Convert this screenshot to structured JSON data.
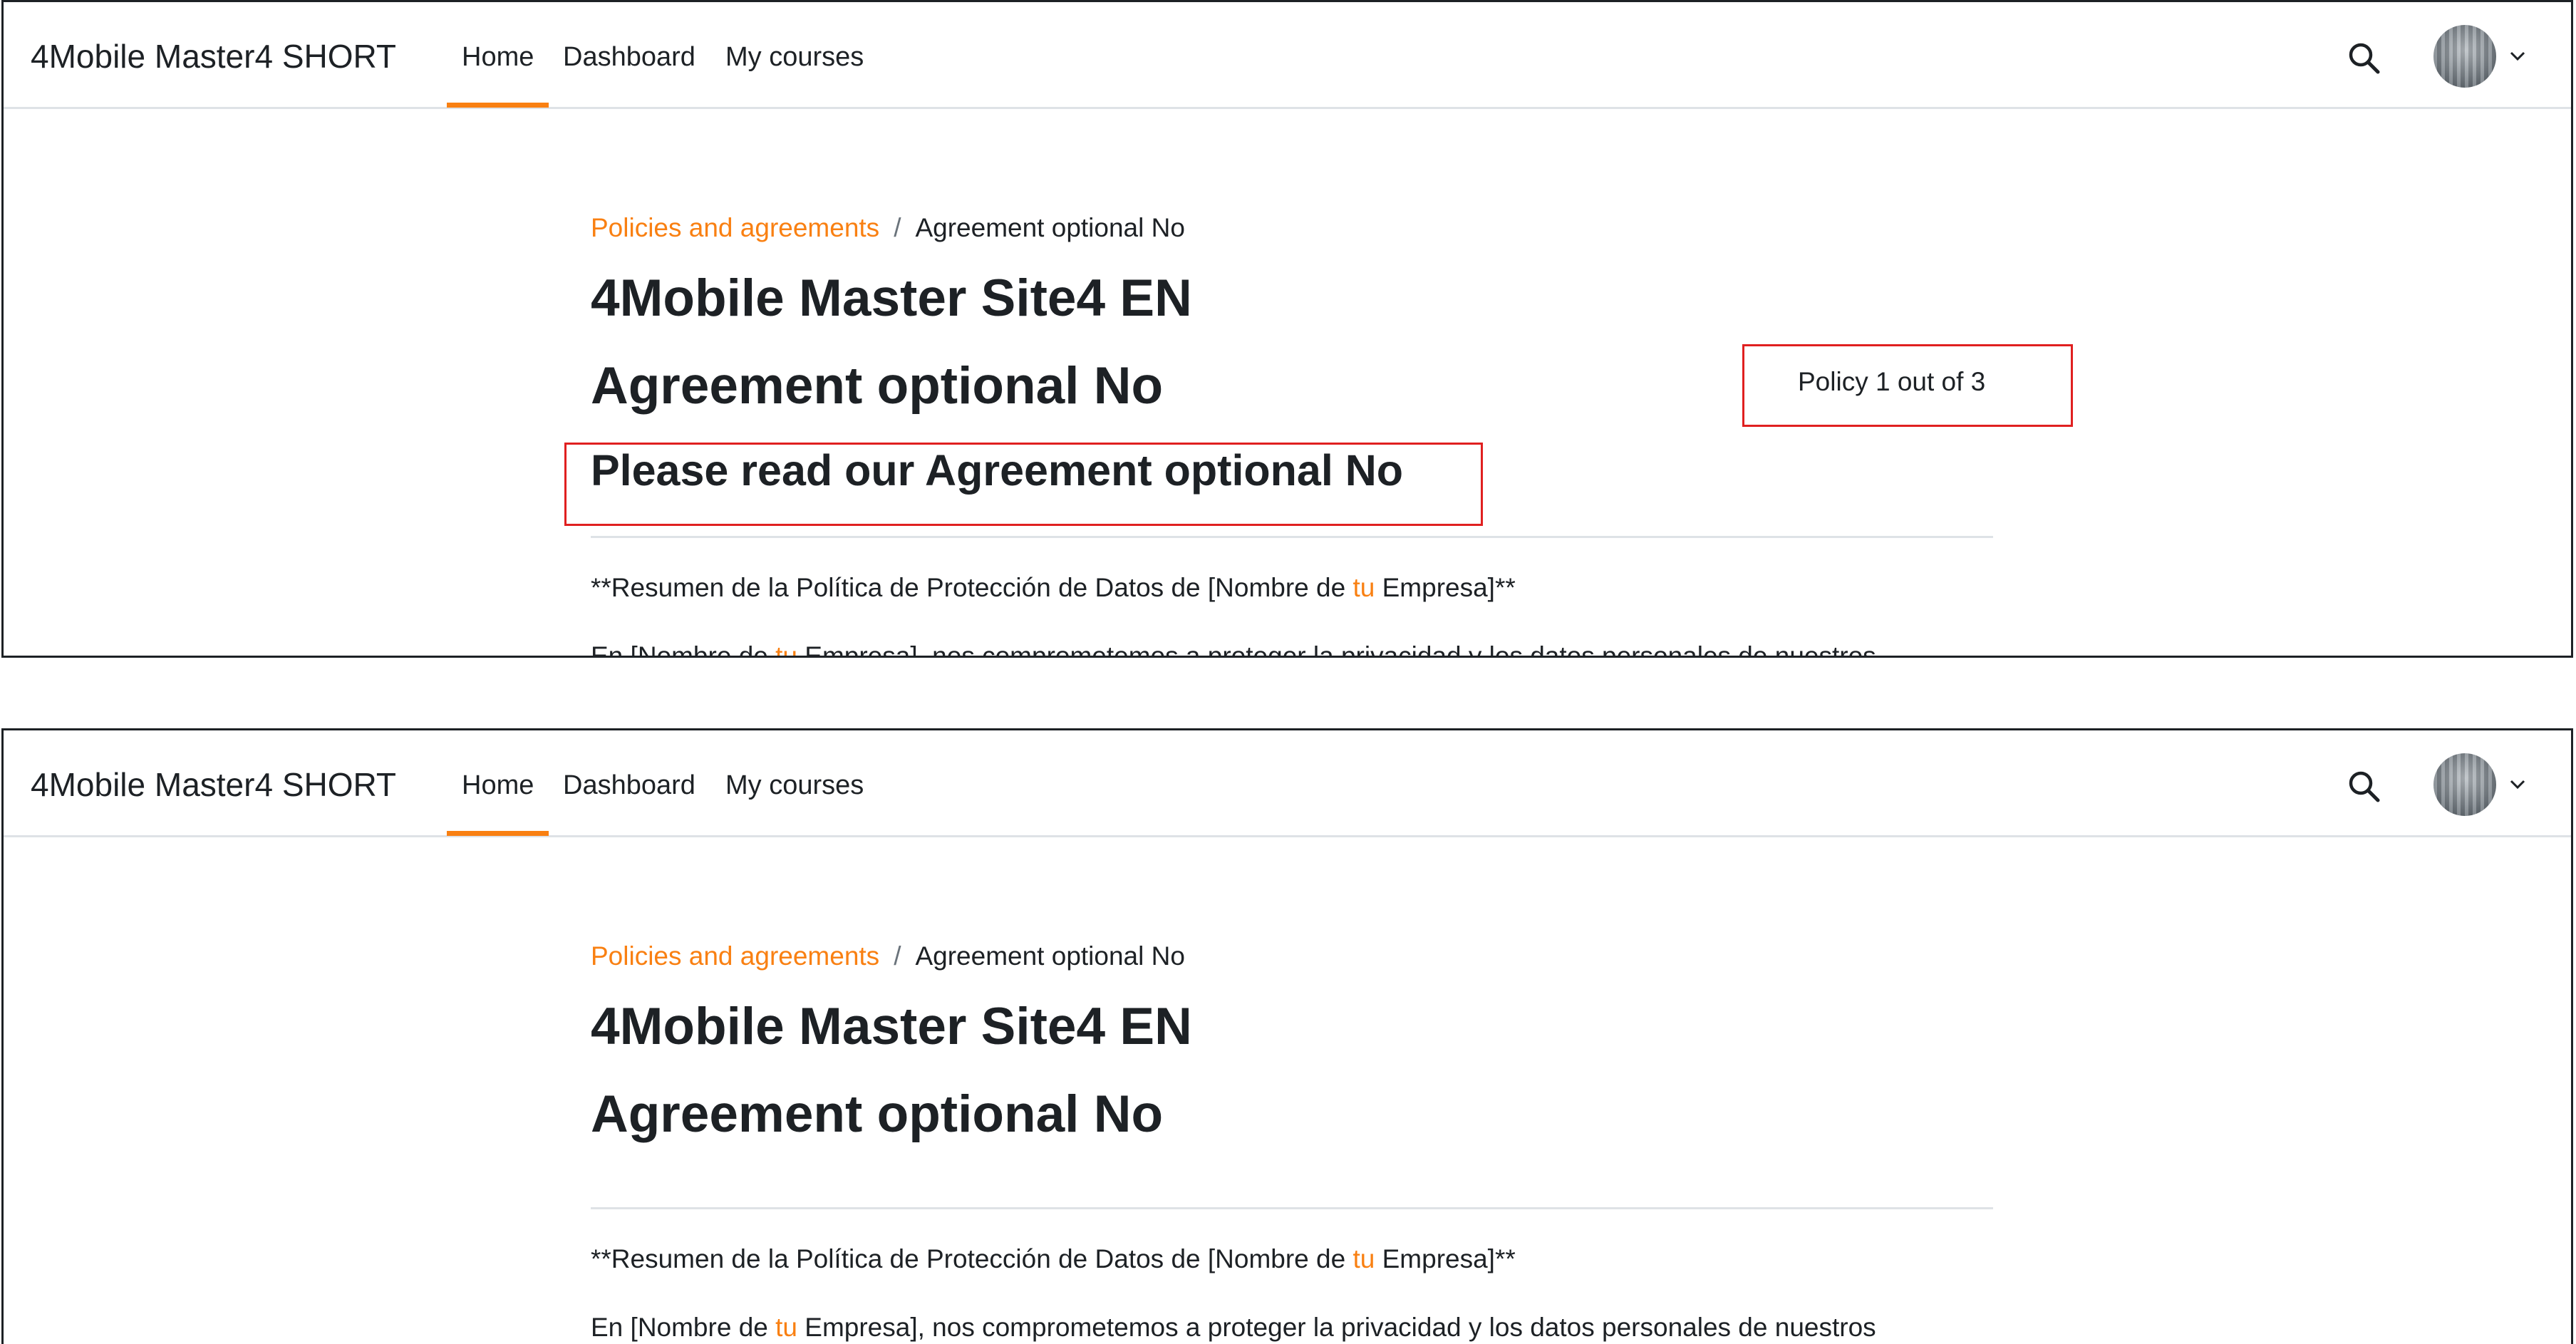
{
  "navbar": {
    "brand": "4Mobile Master4 SHORT",
    "items": [
      {
        "label": "Home",
        "active": true
      },
      {
        "label": "Dashboard"
      },
      {
        "label": "My courses"
      }
    ],
    "accent_color": "#f98012"
  },
  "breadcrumb": {
    "parent": "Policies and agreements",
    "separator": "/",
    "current": "Agreement optional No"
  },
  "page": {
    "site_title": "4Mobile Master Site4 EN",
    "policy_title": "Agreement optional No",
    "please_read": "Please read our Agreement optional No",
    "policy_count": "Policy 1 out of 3"
  },
  "body": {
    "summary_prefix": "**Resumen de la Política de Protección de Datos de [Nombre de ",
    "summary_accent": "tu",
    "summary_suffix": " Empresa]**",
    "intro_prefix": "En [Nombre de ",
    "intro_accent": "tu",
    "intro_suffix": " Empresa], nos comprometemos a proteger la privacidad y los datos personales de nuestros"
  },
  "icons": {
    "search": "search-icon",
    "user_menu": "chevron-down-icon"
  }
}
